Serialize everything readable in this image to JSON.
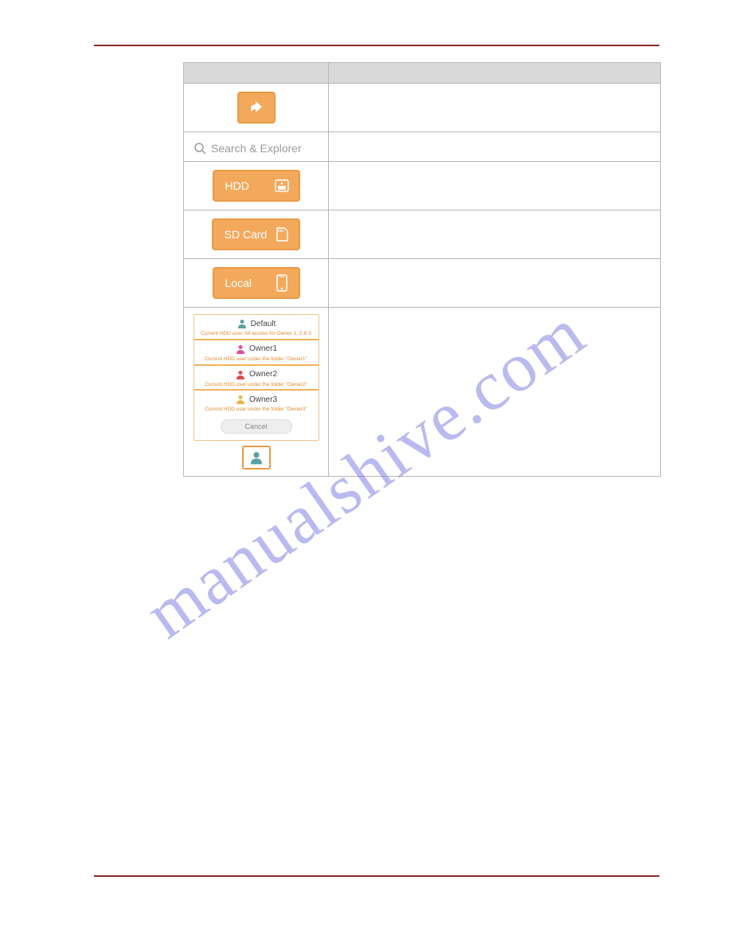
{
  "watermark": "manualshive.com",
  "table": {
    "header": {
      "icon_col": "",
      "desc_col": ""
    },
    "rows": {
      "share": {
        "label": "",
        "desc": ""
      },
      "search": {
        "placeholder": "Search & Explorer",
        "desc": ""
      },
      "hdd": {
        "label": "HDD",
        "desc": ""
      },
      "sdcard": {
        "label": "SD Card",
        "desc": ""
      },
      "local": {
        "label": "Local",
        "desc": ""
      },
      "owners": {
        "desc": ""
      }
    }
  },
  "owner_picker": {
    "items": [
      {
        "name": "Default",
        "note": "Current HDD user. All access for Owner 1, 2 & 3",
        "color": "#5aa0a0"
      },
      {
        "name": "Owner1",
        "note": "Current HDD user under the folder \"Owner1\"",
        "color": "#d94fa0"
      },
      {
        "name": "Owner2",
        "note": "Current HDD user under the folder \"Owner2\"",
        "color": "#d94f4f"
      },
      {
        "name": "Owner3",
        "note": "Current HDD user under the folder \"Owner3\"",
        "color": "#e6b84f"
      }
    ],
    "cancel": "Cancel"
  }
}
